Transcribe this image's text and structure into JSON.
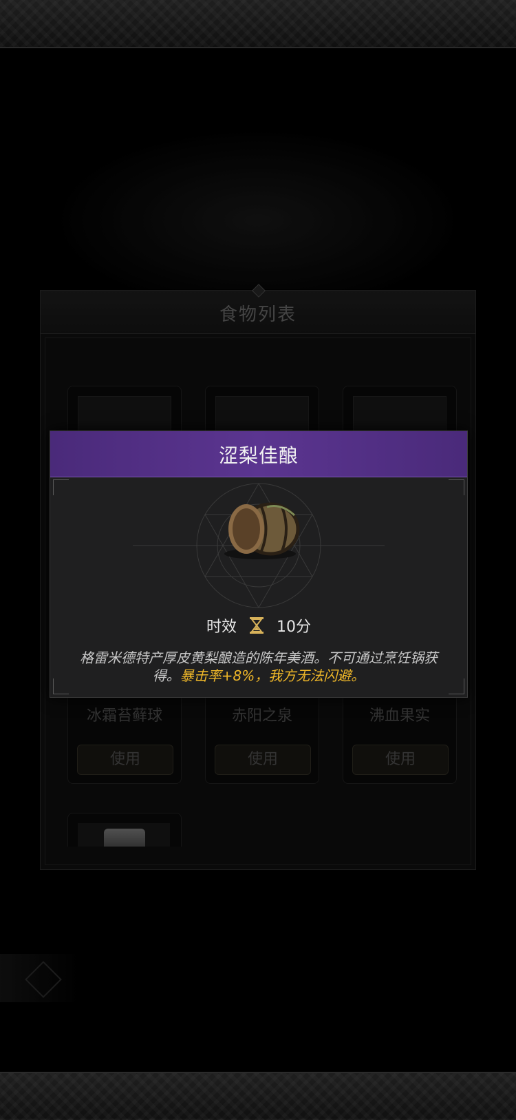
{
  "food_panel": {
    "title": "食物列表",
    "cards": [
      {
        "name": "冰霜苔藓球",
        "use_label": "使用"
      },
      {
        "name": "赤阳之泉",
        "use_label": "使用"
      },
      {
        "name": "沸血果实",
        "use_label": "使用"
      }
    ]
  },
  "tooltip": {
    "title": "涩梨佳酿",
    "duration_label": "时效",
    "duration_value": "10分",
    "description_plain": "格雷米德特产厚皮黄梨酿造的陈年美酒。不可通过烹饪锅获得。",
    "description_effect": "暴击率+8%，我方无法闪避。",
    "header_color": "#5b3590",
    "effect_color": "#f0b829",
    "item_icon": "barrel-icon",
    "duration_icon": "hourglass-icon"
  }
}
